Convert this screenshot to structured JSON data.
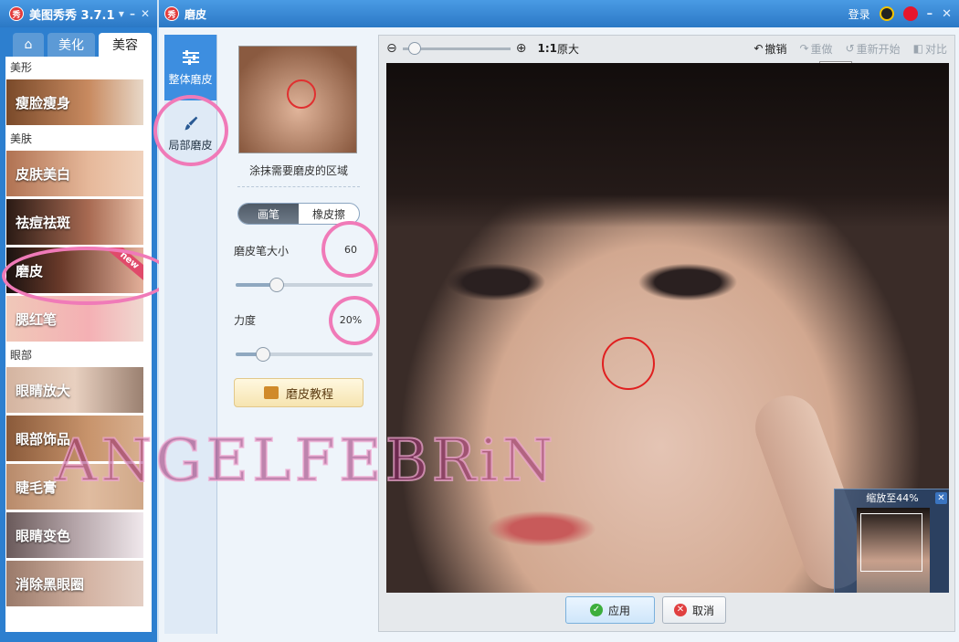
{
  "app": {
    "title": "美图秀秀 3.7.1",
    "logo_text": "秀",
    "controls": [
      "▾",
      "–",
      "✕"
    ],
    "tabs": {
      "home_icon": "⌂",
      "beautify": "美化",
      "beauty": "美容"
    }
  },
  "left_menu": {
    "sections": {
      "shape": "美形",
      "skin": "美肤",
      "eyes": "眼部"
    },
    "items": {
      "slim_face": "瘦脸瘦身",
      "skin_whitening": "皮肤美白",
      "acne_removal": "祛痘祛斑",
      "skin_smoothing": "磨皮",
      "blush": "腮红笔",
      "eye_enlarge": "眼睛放大",
      "eye_accessories": "眼部饰品",
      "mascara": "睫毛膏",
      "eye_color": "眼睛变色",
      "dark_circles": "消除黑眼圈"
    },
    "new_badge": "new"
  },
  "dialog": {
    "title": "磨皮",
    "logo_text": "秀",
    "login": "登录",
    "controls": [
      "–",
      "✕"
    ]
  },
  "modes": {
    "overall": "整体磨皮",
    "partial": "局部磨皮"
  },
  "controls": {
    "hint": "涂抹需要磨皮的区域",
    "brush": "画笔",
    "eraser": "橡皮擦",
    "brush_size_label": "磨皮笔大小",
    "brush_size_value": "60",
    "brush_size_fraction": 0.3,
    "strength_label": "力度",
    "strength_value": "20%",
    "strength_fraction": 0.2,
    "tutorial": "磨皮教程"
  },
  "toolbar": {
    "zoom_out": "⊖",
    "zoom_in": "⊕",
    "ratio_bold": "1:1",
    "ratio_text": "原大",
    "undo": "撤销",
    "redo": "重做",
    "restart": "重新开始",
    "compare": "对比",
    "tooltip": "重做"
  },
  "navigator": {
    "title": "缩放至44%",
    "close": "✕"
  },
  "footer": {
    "apply": "应用",
    "cancel": "取消"
  },
  "watermark": "ANGELFEBRiN",
  "colors": {
    "titlebar": "#2b78c5",
    "accent_pink": "#f07ab8",
    "brush_ring": "#e02020"
  }
}
